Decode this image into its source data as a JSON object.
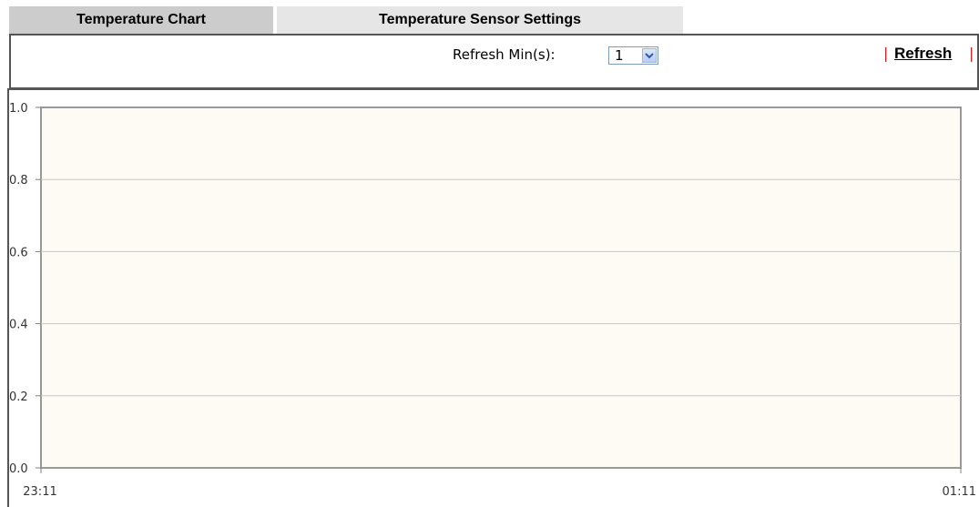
{
  "tabs": [
    {
      "label": "Temperature Chart",
      "active": true
    },
    {
      "label": "Temperature Sensor Settings",
      "active": false
    }
  ],
  "toolbar": {
    "refresh_label": "Refresh Min(s):",
    "refresh_value": "1",
    "separator": "|",
    "refresh_link": "Refresh"
  },
  "colors": {
    "plot_background": "#fdfbf4",
    "separator": "#cc2222",
    "tab_active": "#cccccc",
    "tab_inactive": "#e6e6e6"
  },
  "chart_data": {
    "type": "line",
    "title": "",
    "xlabel": "",
    "ylabel": "",
    "ylim": [
      0.0,
      1.0
    ],
    "yticks": [
      "0.0",
      "0.2",
      "0.4",
      "0.6",
      "0.8",
      "1.0"
    ],
    "xticks": [
      "23:11",
      "01:11"
    ],
    "grid": true,
    "series": []
  }
}
